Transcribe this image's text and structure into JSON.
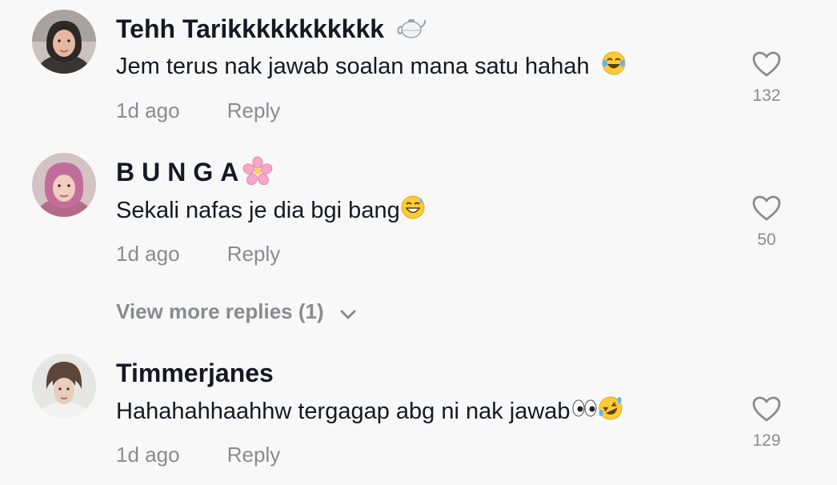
{
  "comments": [
    {
      "username": "Tehh Tarikkkkkkkkkkk",
      "username_emoji": "teapot-emoji",
      "text": "Jem terus nak jawab soalan mana satu hahah",
      "text_emoji": "tears-of-joy-emoji",
      "time": "1d ago",
      "reply_label": "Reply",
      "likes": "132"
    },
    {
      "username": "BUNGA",
      "username_emoji": "cherry-blossom-emoji",
      "text": "Sekali nafas je dia bgi bang",
      "text_emoji": "grinning-sweat-emoji",
      "time": "1d ago",
      "reply_label": "Reply",
      "likes": "50"
    },
    {
      "username": "Timmerjanes",
      "text": "Hahahahhaahhw tergagap abg ni nak jawab",
      "text_emoji": "eyes-and-rofl-emoji",
      "time": "1d ago",
      "reply_label": "Reply",
      "likes": "129"
    }
  ],
  "view_more_replies": "View more replies (1)",
  "colors": {
    "background": "#f8f8f8",
    "primary_text": "#161823",
    "secondary_text": "#8a8b91"
  }
}
